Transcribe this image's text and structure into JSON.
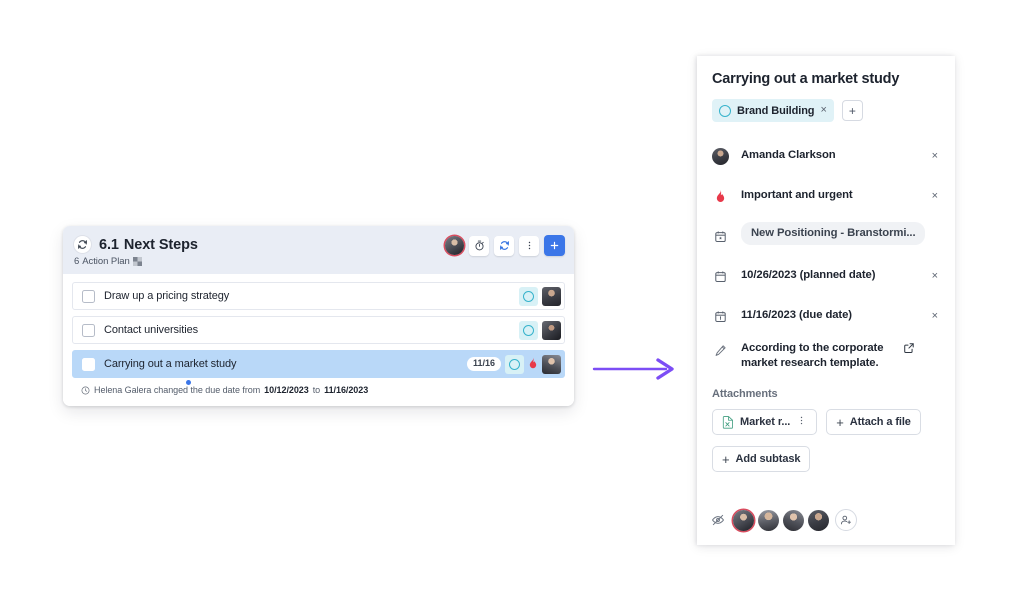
{
  "left_card": {
    "header": {
      "refresh_icon": "sync-icon",
      "number": "6.1",
      "title": "Next Steps",
      "subtitle_count": "6",
      "subtitle_label": "Action Plan",
      "subtitle_icon": "flag-icon",
      "actions": {
        "avatar": "assignee-avatar",
        "timer_icon": "stopwatch-icon",
        "sync_icon": "sync-icon",
        "more_icon": "kebab-menu-icon",
        "add_icon": "plus-icon"
      }
    },
    "tasks": [
      {
        "title": "Draw up a pricing strategy",
        "date": "",
        "has_flame": false,
        "selected": false
      },
      {
        "title": "Contact universities",
        "date": "",
        "has_flame": false,
        "selected": false
      },
      {
        "title": "Carrying out a market study",
        "date": "11/16",
        "has_flame": true,
        "selected": true
      }
    ],
    "activity": {
      "icon": "clock-history-icon",
      "prefix": "Helena Galera changed the due date from",
      "old_date": "10/12/2023",
      "middle": "to",
      "new_date": "11/16/2023"
    }
  },
  "arrow": {
    "name": "flow-arrow",
    "color": "#7c4df5"
  },
  "right_panel": {
    "title": "Carrying out a market study",
    "tag": {
      "label": "Brand Building",
      "remove_label": "×",
      "icon": "circle-outline-icon",
      "bg": "#e0f2f7",
      "ring_color": "#37b3cc"
    },
    "add_tag_label": "+",
    "properties": [
      {
        "icon": "avatar-icon",
        "text": "Amanda Clarkson",
        "style": "plain",
        "action": "remove",
        "action_label": "×"
      },
      {
        "icon": "flame-icon",
        "text": "Important and urgent",
        "style": "plain",
        "action": "remove",
        "action_label": "×"
      },
      {
        "icon": "calendar-star-icon",
        "text": "New Positioning - Branstormi...",
        "style": "pill",
        "action": "none",
        "action_label": ""
      },
      {
        "icon": "calendar-icon",
        "text": "10/26/2023 (planned date)",
        "style": "plain",
        "action": "remove",
        "action_label": "×"
      },
      {
        "icon": "calendar-alert-icon",
        "text": "11/16/2023 (due date)",
        "style": "plain",
        "action": "remove",
        "action_label": "×"
      },
      {
        "icon": "pencil-icon",
        "text": "According to the corporate market research template.",
        "style": "plain",
        "action": "external",
        "action_label": ""
      }
    ],
    "attachments": {
      "section_label": "Attachments",
      "file": {
        "name": "Market r...",
        "icon": "spreadsheet-file-icon",
        "menu_icon": "kebab-menu-icon"
      },
      "attach_button": "Attach a file",
      "attach_icon": "plus-icon"
    },
    "add_subtask": {
      "label": "Add subtask",
      "icon": "plus-icon"
    },
    "footer": {
      "watch_icon": "eye-off-icon",
      "avatar_count": 4,
      "add_person_icon": "person-add-icon"
    }
  }
}
